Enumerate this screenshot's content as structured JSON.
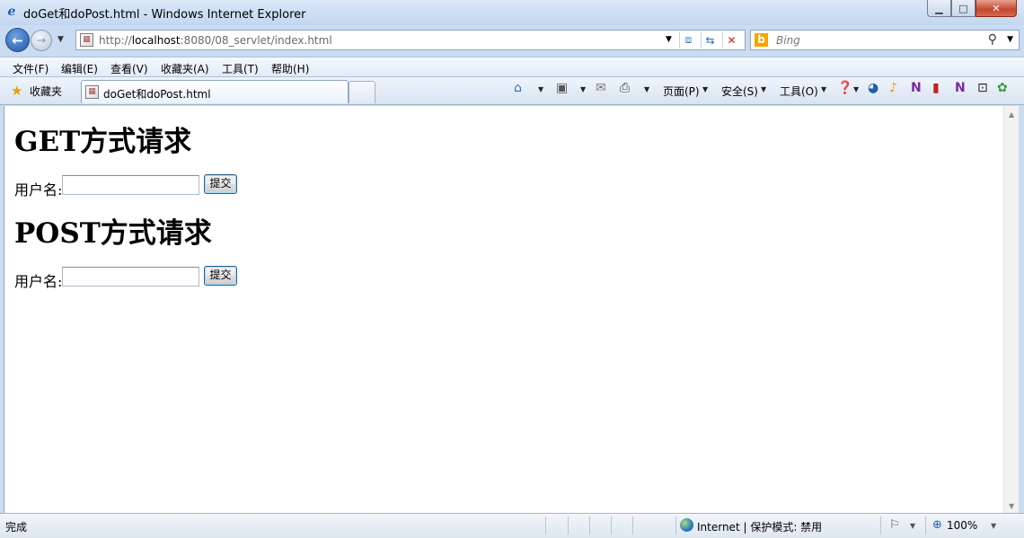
{
  "window": {
    "title": "doGet和doPost.html - Windows Internet Explorer",
    "controls": [
      "minimize",
      "maximize",
      "close"
    ]
  },
  "address_bar": {
    "url_prefix": "http://",
    "url_host": "localhost",
    "url_rest": ":8080/08_servlet/index.html"
  },
  "search": {
    "placeholder": "Bing"
  },
  "menu": {
    "items": [
      "文件(F)",
      "编辑(E)",
      "查看(V)",
      "收藏夹(A)",
      "工具(T)",
      "帮助(H)"
    ]
  },
  "favorites": {
    "label": "收藏夹"
  },
  "tab": {
    "label": "doGet和doPost.html"
  },
  "command_bar": {
    "page": "页面(P)",
    "safety": "安全(S)",
    "tools": "工具(O)"
  },
  "page": {
    "get_heading": "GET方式请求",
    "get_label": "用户名:",
    "get_submit": "提交",
    "post_heading": "POST方式请求",
    "post_label": "用户名:",
    "post_submit": "提交"
  },
  "status": {
    "left": "完成",
    "zone": "Internet | 保护模式: 禁用",
    "zoom": "100%"
  }
}
